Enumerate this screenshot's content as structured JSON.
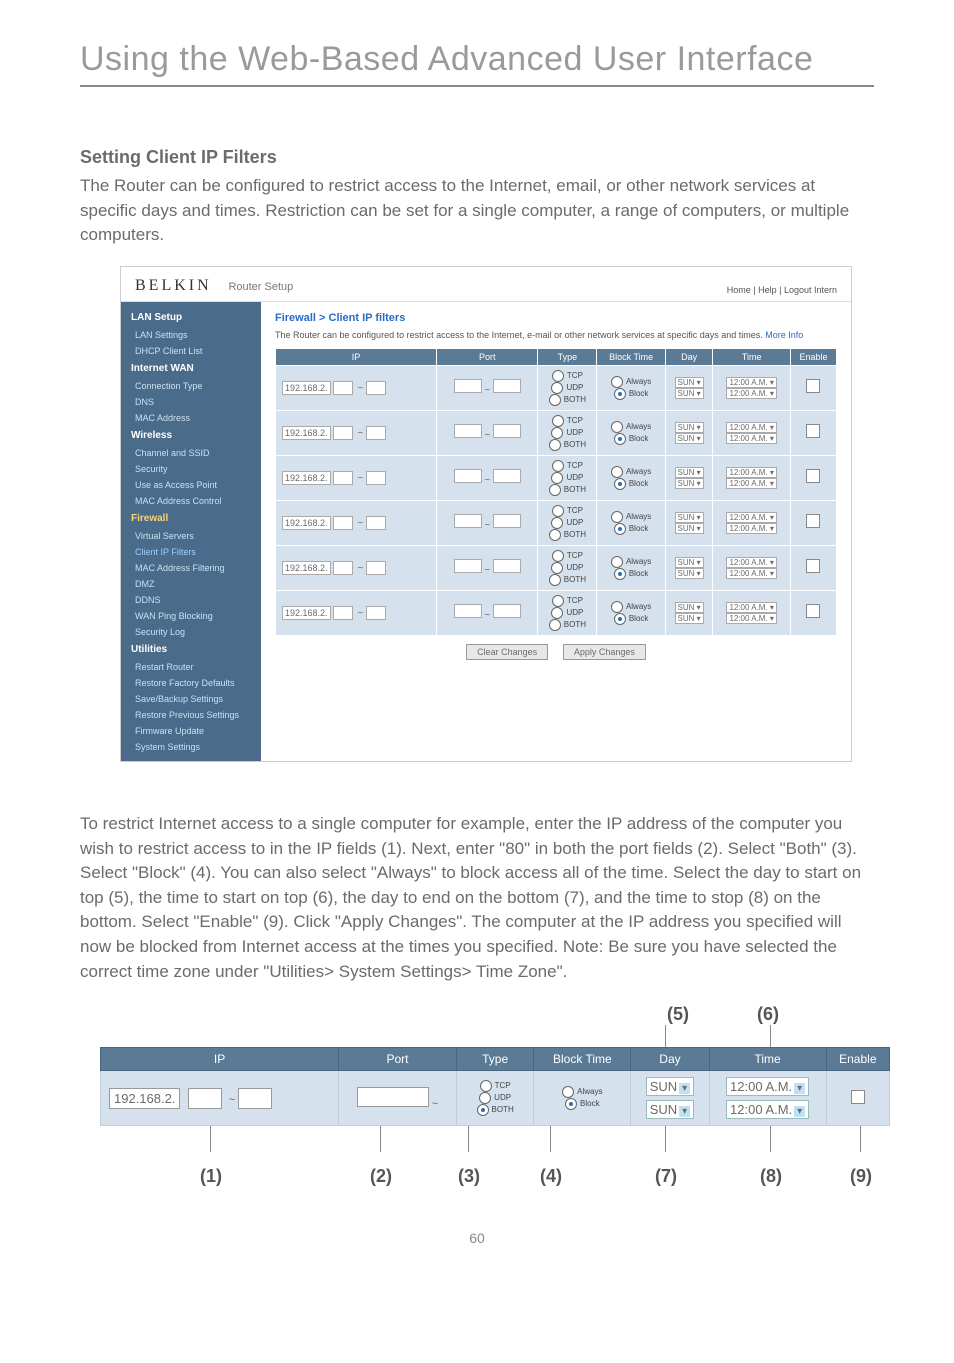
{
  "page_title": "Using the Web-Based Advanced User Interface",
  "section_heading": "Setting Client IP Filters",
  "intro_paragraph": "The Router can be configured to restrict access to the Internet, email, or other network services at specific days and times. Restriction can be set for a single computer, a range of computers, or multiple computers.",
  "body_paragraph": "To restrict Internet access to a single computer for example, enter the IP address of the computer you wish to restrict access to in the IP fields (1). Next, enter \"80\" in both the port fields (2). Select \"Both\" (3). Select \"Block\" (4). You can also select \"Always\" to block access all of the time. Select the day to start on top (5), the time to start on top (6), the day to end on the bottom (7), and the time to stop (8) on the bottom. Select \"Enable\" (9). Click \"Apply Changes\". The computer at the IP address you specified will now be blocked from Internet access at the times you specified. Note: Be sure you have selected the correct time zone under \"Utilities> System Settings> Time Zone\".",
  "page_number": "60",
  "screenshot": {
    "brand": "BELKIN",
    "brand_sub": "Router Setup",
    "top_links": "Home | Help | Logout   Intern",
    "breadcrumb": "Firewall > Client IP filters",
    "description": "The Router can be configured to restrict access to the Internet, e-mail or other network services at specific days and times.",
    "more_info": "More Info",
    "sidebar": {
      "groups": [
        {
          "header": "LAN Setup",
          "items": [
            "LAN Settings",
            "DHCP Client List"
          ]
        },
        {
          "header": "Internet WAN",
          "items": [
            "Connection Type",
            "DNS",
            "MAC Address"
          ]
        },
        {
          "header": "Wireless",
          "items": [
            "Channel and SSID",
            "Security",
            "Use as Access Point",
            "MAC Address Control"
          ]
        },
        {
          "header_fw": "Firewall",
          "items": [
            "Virtual Servers",
            "Client IP Filters",
            "MAC Address Filtering",
            "DMZ",
            "DDNS",
            "WAN Ping Blocking",
            "Security Log"
          ]
        },
        {
          "header": "Utilities",
          "items": [
            "Restart Router",
            "Restore Factory Defaults",
            "Save/Backup Settings",
            "Restore Previous Settings",
            "Firmware Update",
            "System Settings"
          ]
        }
      ]
    },
    "table": {
      "headers": [
        "IP",
        "Port",
        "Type",
        "Block Time",
        "Day",
        "Time",
        "Enable"
      ],
      "ip_prefix": "192.168.2.",
      "type_opts": [
        "TCP",
        "UDP",
        "BOTH"
      ],
      "block_opts": [
        "Always",
        "Block"
      ],
      "day": "SUN",
      "time": "12:00 A.M.",
      "rows": 6
    },
    "buttons": {
      "clear": "Clear Changes",
      "apply": "Apply Changes"
    }
  },
  "crop": {
    "top_labels": {
      "5": "(5)",
      "6": "(6)"
    },
    "headers": [
      "IP",
      "Port",
      "Type",
      "Block Time",
      "Day",
      "Time",
      "Enable"
    ],
    "ip_prefix": "192.168.2.",
    "type_opts": [
      "TCP",
      "UDP",
      "BOTH"
    ],
    "block_opts": [
      "Always",
      "Block"
    ],
    "day": "SUN",
    "time": "12:00 A.M.",
    "bottom_labels": {
      "1": "(1)",
      "2": "(2)",
      "3": "(3)",
      "4": "(4)",
      "7": "(7)",
      "8": "(8)",
      "9": "(9)"
    }
  }
}
